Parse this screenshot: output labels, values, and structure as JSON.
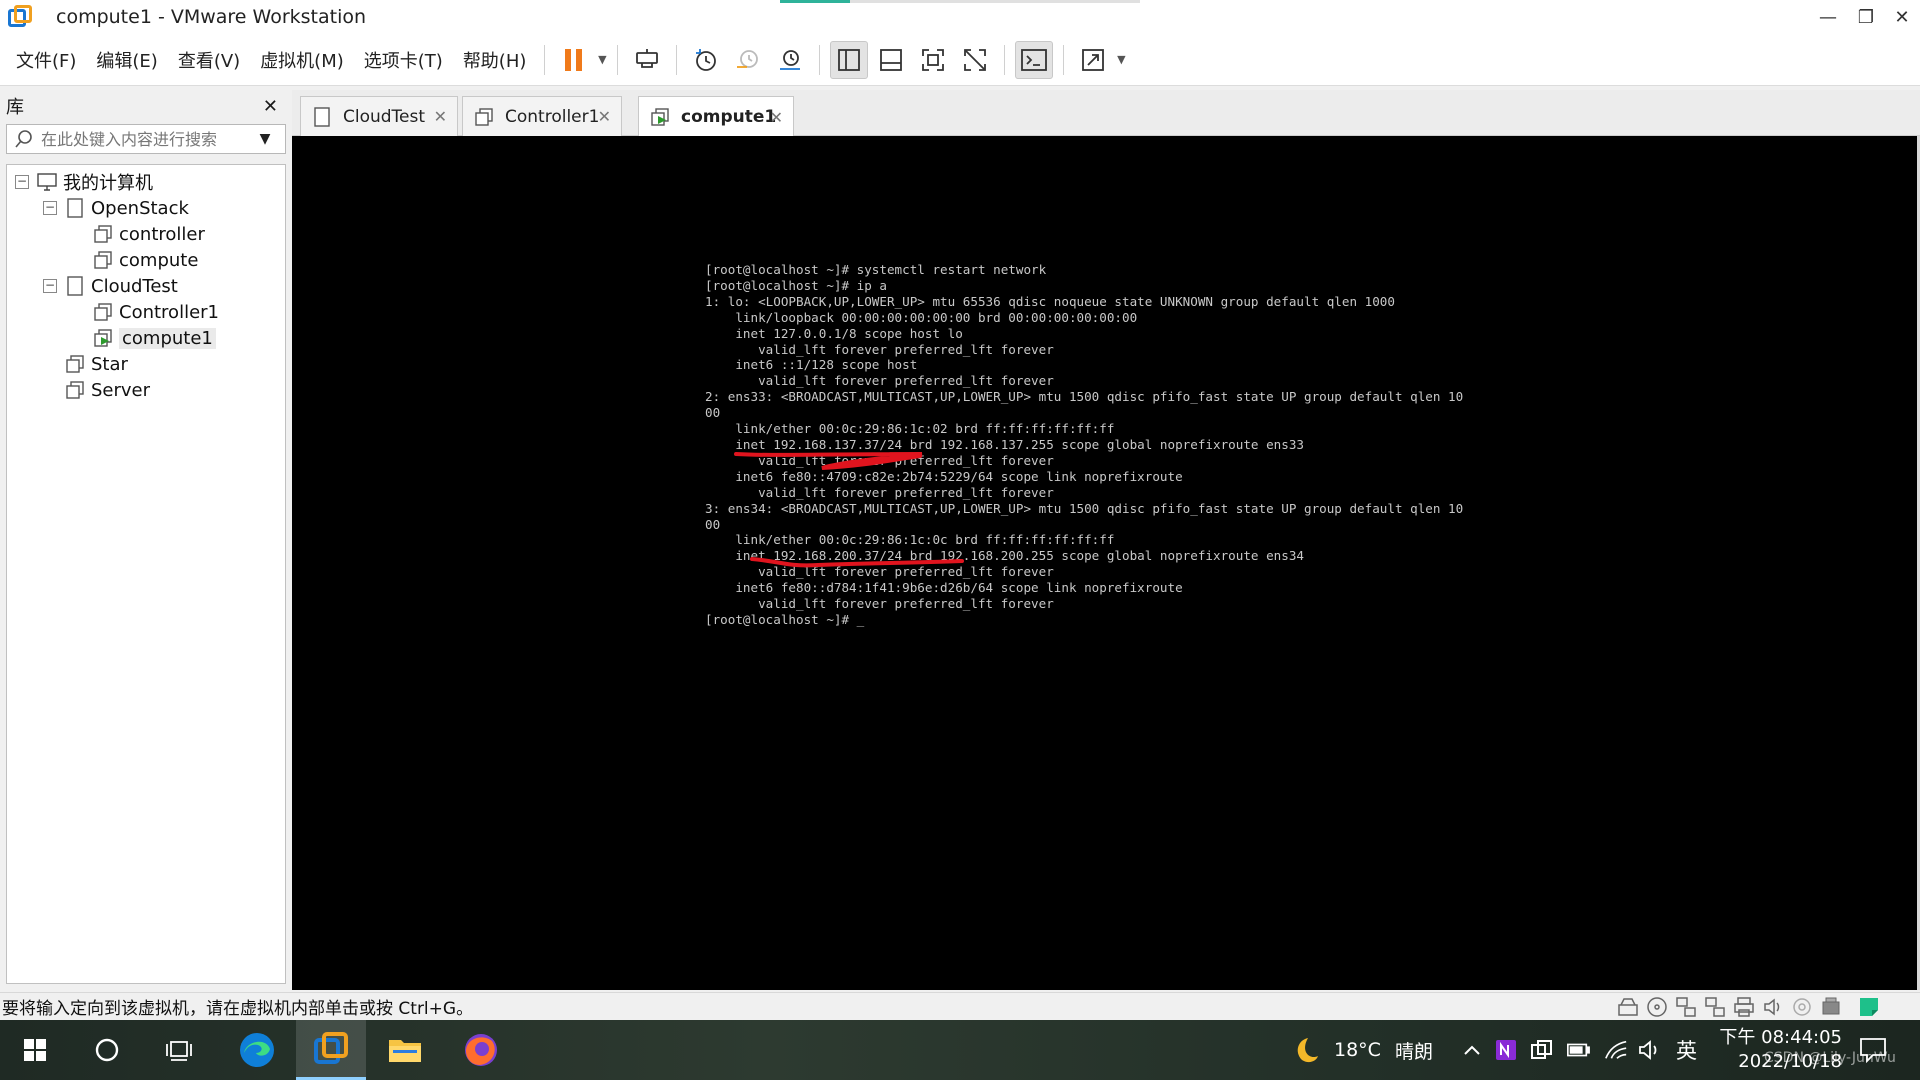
{
  "window": {
    "title": "compute1 - VMware Workstation",
    "minimize": "—",
    "restore": "❐",
    "close": "✕"
  },
  "menu": {
    "items": [
      "文件(F)",
      "编辑(E)",
      "查看(V)",
      "虚拟机(M)",
      "选项卡(T)",
      "帮助(H)"
    ]
  },
  "toolbar": {
    "icons": [
      "pause-icon",
      "send-ctrl-alt-del-icon",
      "snapshot-icon",
      "revert-snapshot-icon",
      "snapshot-manager-icon",
      "show-library-icon",
      "thumbnail-bar-icon",
      "full-screen-icon",
      "unity-icon",
      "console-view-icon",
      "stretch-guest-icon"
    ]
  },
  "library": {
    "title": "库",
    "close": "✕",
    "search_placeholder": "在此处键入内容进行搜索",
    "tree": {
      "root": "我的计算机",
      "openstack": "OpenStack",
      "controller": "controller",
      "compute": "compute",
      "cloudtest": "CloudTest",
      "controller1": "Controller1",
      "compute1": "compute1",
      "star": "Star",
      "server": "Server"
    },
    "expand_minus": "−"
  },
  "tabs": [
    {
      "label": "CloudTest",
      "close": "✕"
    },
    {
      "label": "Controller1",
      "close": "✕"
    },
    {
      "label": "compute1",
      "close": "✕"
    }
  ],
  "terminal": {
    "lines": [
      "[root@localhost ~]# systemctl restart network",
      "[root@localhost ~]# ip a",
      "1: lo: <LOOPBACK,UP,LOWER_UP> mtu 65536 qdisc noqueue state UNKNOWN group default qlen 1000",
      "    link/loopback 00:00:00:00:00:00 brd 00:00:00:00:00:00",
      "    inet 127.0.0.1/8 scope host lo",
      "       valid_lft forever preferred_lft forever",
      "    inet6 ::1/128 scope host",
      "       valid_lft forever preferred_lft forever",
      "2: ens33: <BROADCAST,MULTICAST,UP,LOWER_UP> mtu 1500 qdisc pfifo_fast state UP group default qlen 10",
      "00",
      "    link/ether 00:0c:29:86:1c:02 brd ff:ff:ff:ff:ff:ff",
      "    inet 192.168.137.37/24 brd 192.168.137.255 scope global noprefixroute ens33",
      "       valid_lft forever preferred_lft forever",
      "    inet6 fe80::4709:c82e:2b74:5229/64 scope link noprefixroute",
      "       valid_lft forever preferred_lft forever",
      "3: ens34: <BROADCAST,MULTICAST,UP,LOWER_UP> mtu 1500 qdisc pfifo_fast state UP group default qlen 10",
      "00",
      "    link/ether 00:0c:29:86:1c:0c brd ff:ff:ff:ff:ff:ff",
      "    inet 192.168.200.37/24 brd 192.168.200.255 scope global noprefixroute ens34",
      "       valid_lft forever preferred_lft forever",
      "    inet6 fe80::d784:1f41:9b6e:d26b/64 scope link noprefixroute",
      "       valid_lft forever preferred_lft forever",
      "[root@localhost ~]# _"
    ]
  },
  "status": {
    "message": "要将输入定向到该虚拟机，请在虚拟机内部单击或按 Ctrl+G。"
  },
  "taskbar": {
    "weather_temp": "18°C",
    "weather_desc": "晴朗",
    "ime": "英",
    "time": "下午 08:44:05",
    "date": "2022/10/18",
    "watermark": "CSDN @Lily-JunWu"
  },
  "colors": {
    "annotation_red": "#e0141e",
    "vmware_blue": "#1976d2",
    "vmware_orange": "#f0a020",
    "pause_orange": "#f07a1a"
  }
}
